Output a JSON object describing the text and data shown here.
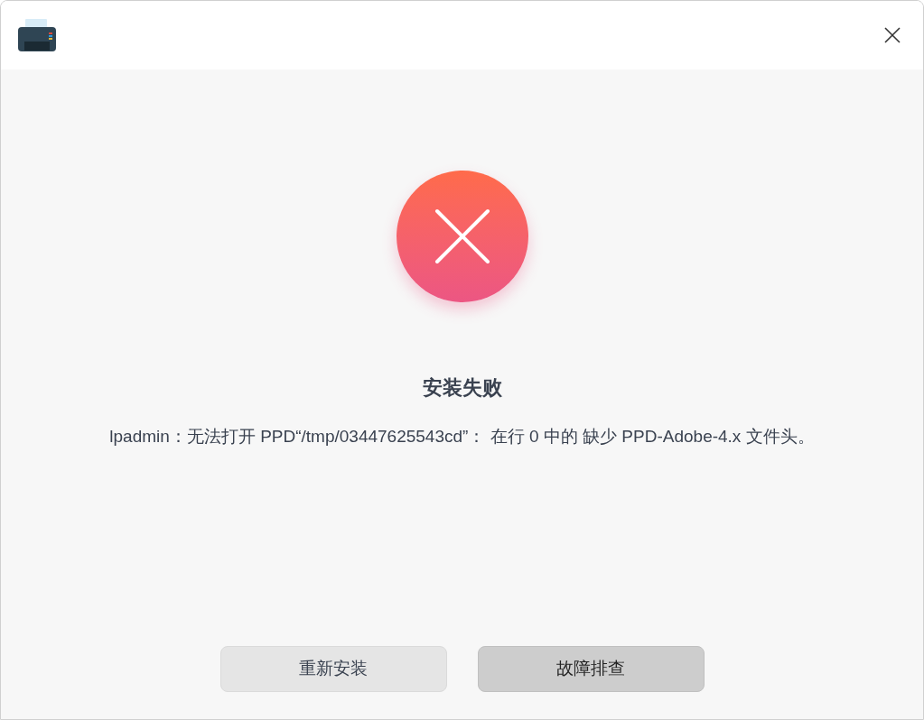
{
  "dialog": {
    "title": "安装失败",
    "message": "lpadmin：无法打开 PPD“/tmp/03447625543cd”： 在行 0 中的 缺少 PPD-Adobe-4.x 文件头。"
  },
  "buttons": [
    {
      "label": "重新安装",
      "highlighted": false
    },
    {
      "label": "故障排查",
      "highlighted": true
    }
  ]
}
